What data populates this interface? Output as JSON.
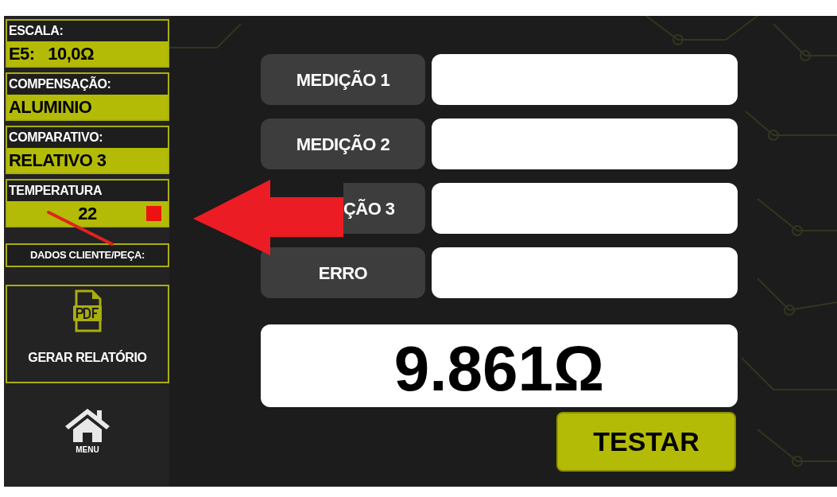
{
  "sidebar": {
    "panels": [
      {
        "label": "ESCALA:",
        "value": "E5:   10,0Ω",
        "indicator": false
      },
      {
        "label": "COMPENSAÇÃO:",
        "value": "ALUMINIO",
        "indicator": false
      },
      {
        "label": "COMPARATIVO:",
        "value": "RELATIVO 3",
        "indicator": false
      },
      {
        "label": "TEMPERATURA",
        "value": "22",
        "indicator": true
      }
    ],
    "client_button": "DADOS CLIENTE/PEÇA:",
    "report_button": "GERAR RELATÓRIO",
    "menu_button": "MENU"
  },
  "measurements": [
    {
      "label": "MEDIÇÃO 1"
    },
    {
      "label": "MEDIÇÃO 2"
    },
    {
      "label": "ÇÃO 3",
      "partly_covered": true
    },
    {
      "label": "ERRO"
    }
  ],
  "result": "9.861Ω",
  "test_button": "TESTAR"
}
